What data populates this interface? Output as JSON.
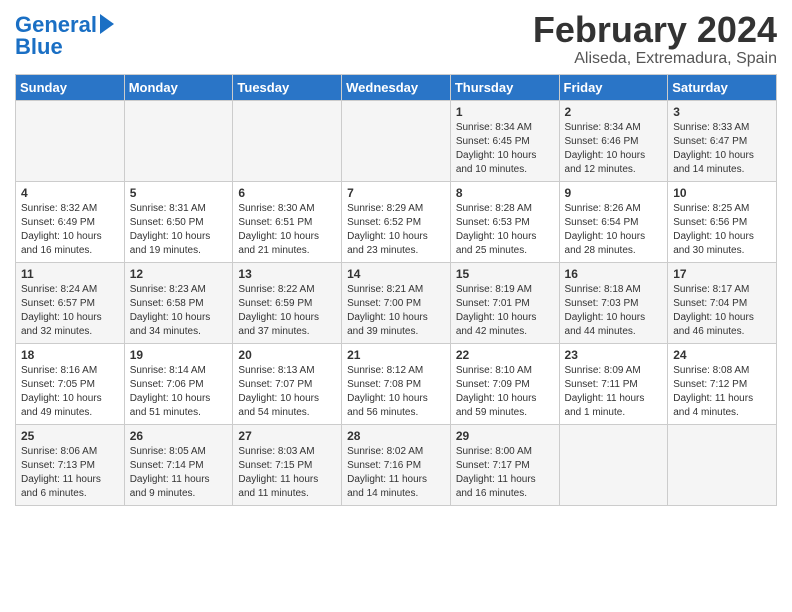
{
  "header": {
    "logo_line1": "General",
    "logo_line2": "Blue",
    "title": "February 2024",
    "subtitle": "Aliseda, Extremadura, Spain"
  },
  "days_of_week": [
    "Sunday",
    "Monday",
    "Tuesday",
    "Wednesday",
    "Thursday",
    "Friday",
    "Saturday"
  ],
  "weeks": [
    [
      {
        "day": "",
        "info": ""
      },
      {
        "day": "",
        "info": ""
      },
      {
        "day": "",
        "info": ""
      },
      {
        "day": "",
        "info": ""
      },
      {
        "day": "1",
        "info": "Sunrise: 8:34 AM\nSunset: 6:45 PM\nDaylight: 10 hours\nand 10 minutes."
      },
      {
        "day": "2",
        "info": "Sunrise: 8:34 AM\nSunset: 6:46 PM\nDaylight: 10 hours\nand 12 minutes."
      },
      {
        "day": "3",
        "info": "Sunrise: 8:33 AM\nSunset: 6:47 PM\nDaylight: 10 hours\nand 14 minutes."
      }
    ],
    [
      {
        "day": "4",
        "info": "Sunrise: 8:32 AM\nSunset: 6:49 PM\nDaylight: 10 hours\nand 16 minutes."
      },
      {
        "day": "5",
        "info": "Sunrise: 8:31 AM\nSunset: 6:50 PM\nDaylight: 10 hours\nand 19 minutes."
      },
      {
        "day": "6",
        "info": "Sunrise: 8:30 AM\nSunset: 6:51 PM\nDaylight: 10 hours\nand 21 minutes."
      },
      {
        "day": "7",
        "info": "Sunrise: 8:29 AM\nSunset: 6:52 PM\nDaylight: 10 hours\nand 23 minutes."
      },
      {
        "day": "8",
        "info": "Sunrise: 8:28 AM\nSunset: 6:53 PM\nDaylight: 10 hours\nand 25 minutes."
      },
      {
        "day": "9",
        "info": "Sunrise: 8:26 AM\nSunset: 6:54 PM\nDaylight: 10 hours\nand 28 minutes."
      },
      {
        "day": "10",
        "info": "Sunrise: 8:25 AM\nSunset: 6:56 PM\nDaylight: 10 hours\nand 30 minutes."
      }
    ],
    [
      {
        "day": "11",
        "info": "Sunrise: 8:24 AM\nSunset: 6:57 PM\nDaylight: 10 hours\nand 32 minutes."
      },
      {
        "day": "12",
        "info": "Sunrise: 8:23 AM\nSunset: 6:58 PM\nDaylight: 10 hours\nand 34 minutes."
      },
      {
        "day": "13",
        "info": "Sunrise: 8:22 AM\nSunset: 6:59 PM\nDaylight: 10 hours\nand 37 minutes."
      },
      {
        "day": "14",
        "info": "Sunrise: 8:21 AM\nSunset: 7:00 PM\nDaylight: 10 hours\nand 39 minutes."
      },
      {
        "day": "15",
        "info": "Sunrise: 8:19 AM\nSunset: 7:01 PM\nDaylight: 10 hours\nand 42 minutes."
      },
      {
        "day": "16",
        "info": "Sunrise: 8:18 AM\nSunset: 7:03 PM\nDaylight: 10 hours\nand 44 minutes."
      },
      {
        "day": "17",
        "info": "Sunrise: 8:17 AM\nSunset: 7:04 PM\nDaylight: 10 hours\nand 46 minutes."
      }
    ],
    [
      {
        "day": "18",
        "info": "Sunrise: 8:16 AM\nSunset: 7:05 PM\nDaylight: 10 hours\nand 49 minutes."
      },
      {
        "day": "19",
        "info": "Sunrise: 8:14 AM\nSunset: 7:06 PM\nDaylight: 10 hours\nand 51 minutes."
      },
      {
        "day": "20",
        "info": "Sunrise: 8:13 AM\nSunset: 7:07 PM\nDaylight: 10 hours\nand 54 minutes."
      },
      {
        "day": "21",
        "info": "Sunrise: 8:12 AM\nSunset: 7:08 PM\nDaylight: 10 hours\nand 56 minutes."
      },
      {
        "day": "22",
        "info": "Sunrise: 8:10 AM\nSunset: 7:09 PM\nDaylight: 10 hours\nand 59 minutes."
      },
      {
        "day": "23",
        "info": "Sunrise: 8:09 AM\nSunset: 7:11 PM\nDaylight: 11 hours\nand 1 minute."
      },
      {
        "day": "24",
        "info": "Sunrise: 8:08 AM\nSunset: 7:12 PM\nDaylight: 11 hours\nand 4 minutes."
      }
    ],
    [
      {
        "day": "25",
        "info": "Sunrise: 8:06 AM\nSunset: 7:13 PM\nDaylight: 11 hours\nand 6 minutes."
      },
      {
        "day": "26",
        "info": "Sunrise: 8:05 AM\nSunset: 7:14 PM\nDaylight: 11 hours\nand 9 minutes."
      },
      {
        "day": "27",
        "info": "Sunrise: 8:03 AM\nSunset: 7:15 PM\nDaylight: 11 hours\nand 11 minutes."
      },
      {
        "day": "28",
        "info": "Sunrise: 8:02 AM\nSunset: 7:16 PM\nDaylight: 11 hours\nand 14 minutes."
      },
      {
        "day": "29",
        "info": "Sunrise: 8:00 AM\nSunset: 7:17 PM\nDaylight: 11 hours\nand 16 minutes."
      },
      {
        "day": "",
        "info": ""
      },
      {
        "day": "",
        "info": ""
      }
    ]
  ]
}
